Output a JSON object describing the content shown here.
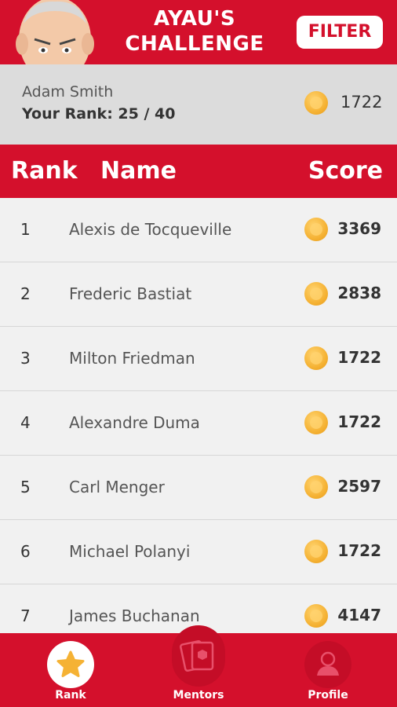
{
  "header": {
    "title": "AYAU'S CHALLENGE",
    "filter_label": "FILTER"
  },
  "user": {
    "name": "Adam Smith",
    "rank_label": "Your Rank:",
    "rank_value": "25 / 40",
    "score": "1722"
  },
  "table": {
    "headers": {
      "rank": "Rank",
      "name": "Name",
      "score": "Score"
    },
    "rows": [
      {
        "rank": "1",
        "name": "Alexis de Tocqueville",
        "score": "3369"
      },
      {
        "rank": "2",
        "name": "Frederic Bastiat",
        "score": "2838"
      },
      {
        "rank": "3",
        "name": "Milton Friedman",
        "score": "1722"
      },
      {
        "rank": "4",
        "name": "Alexandre Duma",
        "score": "1722"
      },
      {
        "rank": "5",
        "name": "Carl Menger",
        "score": "2597"
      },
      {
        "rank": "6",
        "name": "Michael Polanyi",
        "score": "1722"
      },
      {
        "rank": "7",
        "name": "James Buchanan",
        "score": "4147"
      }
    ]
  },
  "nav": {
    "items": [
      {
        "label": "Rank",
        "icon": "star-icon",
        "active": true
      },
      {
        "label": "Mentors",
        "icon": "cards-icon",
        "active": false
      },
      {
        "label": "Profile",
        "icon": "person-icon",
        "active": false
      }
    ]
  },
  "colors": {
    "brand": "#d4102c",
    "coin": "#f5b234",
    "background": "#efefef"
  }
}
